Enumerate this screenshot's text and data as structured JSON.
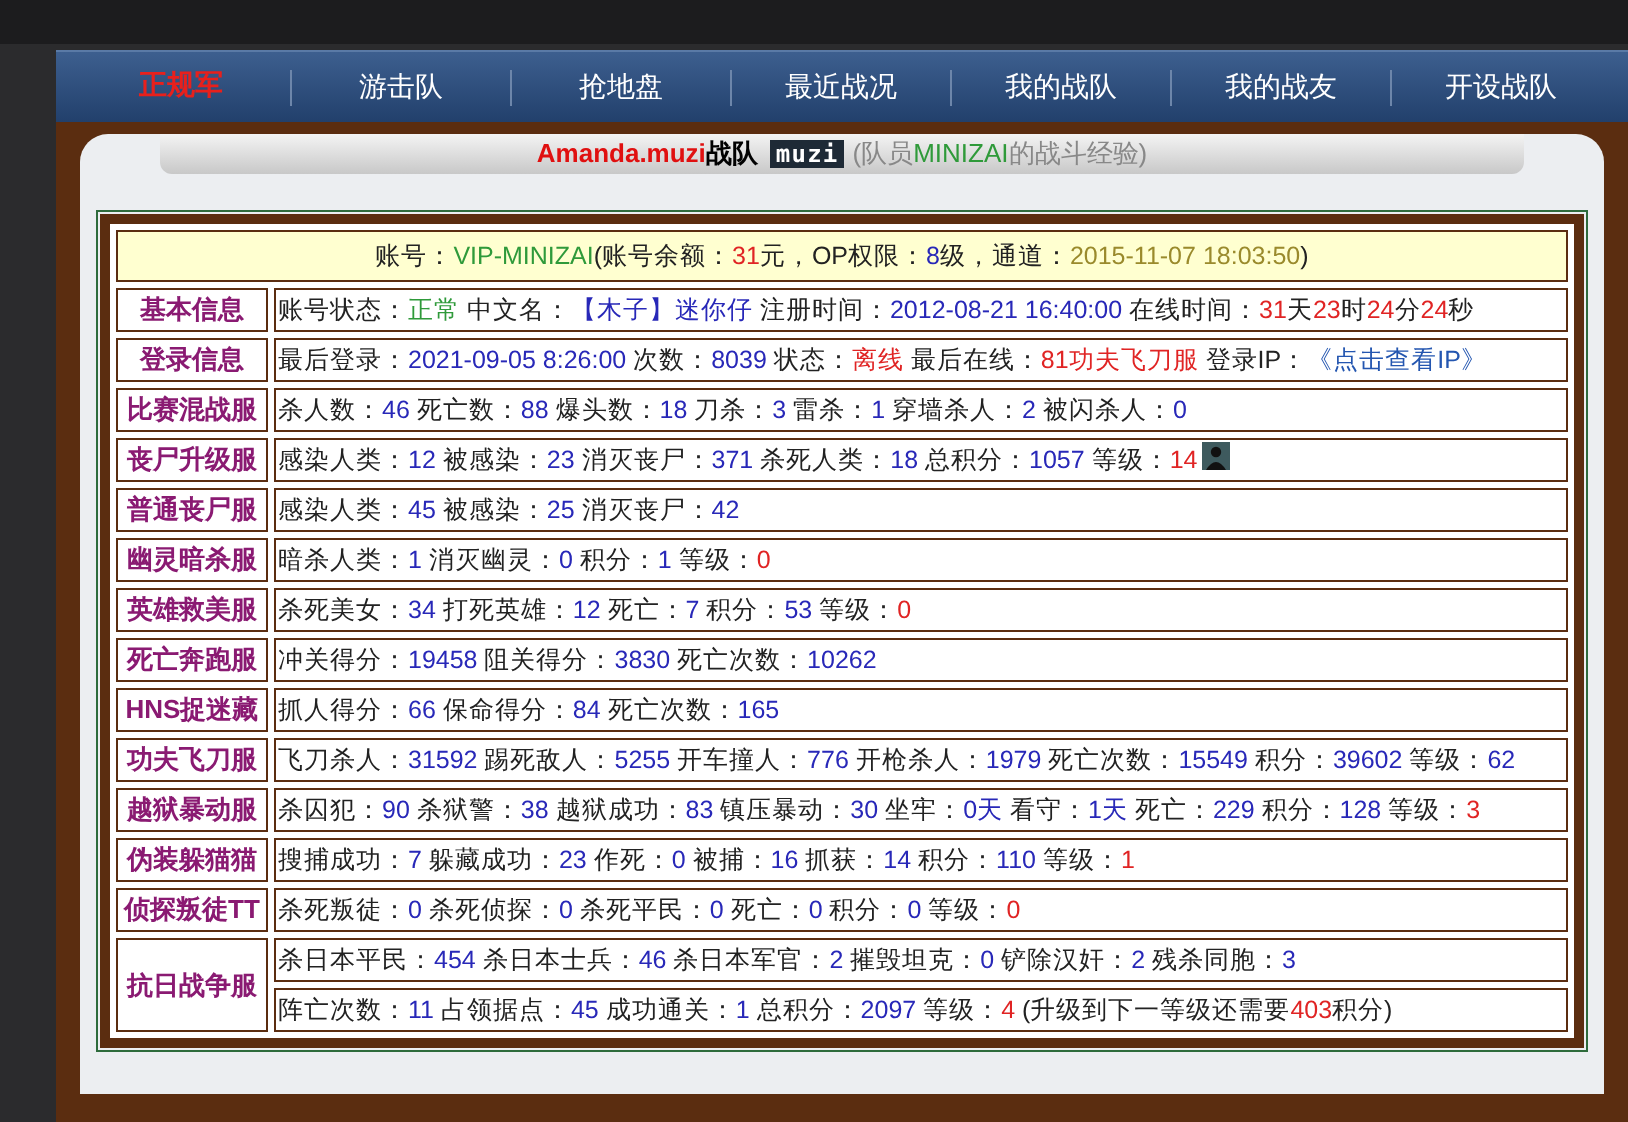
{
  "nav": [
    {
      "label": "正规军",
      "selected": true
    },
    {
      "label": "游击队",
      "selected": false
    },
    {
      "label": "抢地盘",
      "selected": false
    },
    {
      "label": "最近战况",
      "selected": false
    },
    {
      "label": "我的战队",
      "selected": false
    },
    {
      "label": "我的战友",
      "selected": false
    },
    {
      "label": "开设战队",
      "selected": false
    }
  ],
  "header": {
    "team": "Amanda.muzi",
    "team_suffix": "战队",
    "logo": "muzi",
    "subtitle": [
      {
        "kind": "plain",
        "text": "(队员"
      },
      {
        "kind": "green",
        "text": "MINIZAI"
      },
      {
        "kind": "plain",
        "text": "的战斗经验)"
      }
    ]
  },
  "account": [
    {
      "kind": "plain",
      "text": "账号："
    },
    {
      "kind": "green",
      "text": "VIP-MINIZAI"
    },
    {
      "kind": "plain",
      "text": "(账号余额："
    },
    {
      "kind": "red",
      "text": "31"
    },
    {
      "kind": "plain",
      "text": "元，OP权限："
    },
    {
      "kind": "num",
      "text": "8"
    },
    {
      "kind": "plain",
      "text": "级，通道："
    },
    {
      "kind": "gold",
      "text": "2015-11-07 18:03:50"
    },
    {
      "kind": "plain",
      "text": ")"
    }
  ],
  "rows": [
    {
      "label": "基本信息",
      "lines": [
        [
          {
            "kind": "plain",
            "text": "账号状态："
          },
          {
            "kind": "green",
            "text": "正常"
          },
          {
            "kind": "plain",
            "text": " 中文名："
          },
          {
            "kind": "num",
            "text": "【木子】迷你仔"
          },
          {
            "kind": "plain",
            "text": " 注册时间："
          },
          {
            "kind": "num",
            "text": "2012-08-21 16:40:00"
          },
          {
            "kind": "plain",
            "text": " 在线时间："
          },
          {
            "kind": "red",
            "text": "31"
          },
          {
            "kind": "plain",
            "text": "天"
          },
          {
            "kind": "red",
            "text": "23"
          },
          {
            "kind": "plain",
            "text": "时"
          },
          {
            "kind": "red",
            "text": "24"
          },
          {
            "kind": "plain",
            "text": "分"
          },
          {
            "kind": "red",
            "text": "24"
          },
          {
            "kind": "plain",
            "text": "秒"
          }
        ]
      ]
    },
    {
      "label": "登录信息",
      "lines": [
        [
          {
            "kind": "plain",
            "text": "最后登录："
          },
          {
            "kind": "num",
            "text": "2021-09-05 8:26:00"
          },
          {
            "kind": "plain",
            "text": " 次数："
          },
          {
            "kind": "num",
            "text": "8039"
          },
          {
            "kind": "plain",
            "text": " 状态："
          },
          {
            "kind": "red",
            "text": "离线"
          },
          {
            "kind": "plain",
            "text": " 最后在线："
          },
          {
            "kind": "red",
            "text": "81功夫飞刀服"
          },
          {
            "kind": "plain",
            "text": " 登录IP："
          },
          {
            "kind": "link",
            "text": "《点击查看IP》"
          }
        ]
      ]
    },
    {
      "label": "比赛混战服",
      "lines": [
        [
          {
            "kind": "plain",
            "text": "杀人数："
          },
          {
            "kind": "num",
            "text": "46"
          },
          {
            "kind": "plain",
            "text": " 死亡数："
          },
          {
            "kind": "num",
            "text": "88"
          },
          {
            "kind": "plain",
            "text": " 爆头数："
          },
          {
            "kind": "num",
            "text": "18"
          },
          {
            "kind": "plain",
            "text": " 刀杀："
          },
          {
            "kind": "num",
            "text": "3"
          },
          {
            "kind": "plain",
            "text": " 雷杀："
          },
          {
            "kind": "num",
            "text": "1"
          },
          {
            "kind": "plain",
            "text": " 穿墙杀人："
          },
          {
            "kind": "num",
            "text": "2"
          },
          {
            "kind": "plain",
            "text": " 被闪杀人："
          },
          {
            "kind": "num",
            "text": "0"
          }
        ]
      ]
    },
    {
      "label": "丧尸升级服",
      "lines": [
        [
          {
            "kind": "plain",
            "text": "感染人类："
          },
          {
            "kind": "num",
            "text": "12"
          },
          {
            "kind": "plain",
            "text": " 被感染："
          },
          {
            "kind": "num",
            "text": "23"
          },
          {
            "kind": "plain",
            "text": " 消灭丧尸："
          },
          {
            "kind": "num",
            "text": "371"
          },
          {
            "kind": "plain",
            "text": " 杀死人类："
          },
          {
            "kind": "num",
            "text": "18"
          },
          {
            "kind": "plain",
            "text": " 总积分："
          },
          {
            "kind": "num",
            "text": "1057"
          },
          {
            "kind": "plain",
            "text": " 等级："
          },
          {
            "kind": "red",
            "text": "14"
          },
          {
            "kind": "avatar"
          }
        ]
      ]
    },
    {
      "label": "普通丧尸服",
      "lines": [
        [
          {
            "kind": "plain",
            "text": "感染人类："
          },
          {
            "kind": "num",
            "text": "45"
          },
          {
            "kind": "plain",
            "text": " 被感染："
          },
          {
            "kind": "num",
            "text": "25"
          },
          {
            "kind": "plain",
            "text": " 消灭丧尸："
          },
          {
            "kind": "num",
            "text": "42"
          }
        ]
      ]
    },
    {
      "label": "幽灵暗杀服",
      "lines": [
        [
          {
            "kind": "plain",
            "text": "暗杀人类："
          },
          {
            "kind": "num",
            "text": "1"
          },
          {
            "kind": "plain",
            "text": " 消灭幽灵："
          },
          {
            "kind": "num",
            "text": "0"
          },
          {
            "kind": "plain",
            "text": " 积分："
          },
          {
            "kind": "num",
            "text": "1"
          },
          {
            "kind": "plain",
            "text": " 等级："
          },
          {
            "kind": "red",
            "text": "0"
          }
        ]
      ]
    },
    {
      "label": "英雄救美服",
      "lines": [
        [
          {
            "kind": "plain",
            "text": "杀死美女："
          },
          {
            "kind": "num",
            "text": "34"
          },
          {
            "kind": "plain",
            "text": " 打死英雄："
          },
          {
            "kind": "num",
            "text": "12"
          },
          {
            "kind": "plain",
            "text": " 死亡："
          },
          {
            "kind": "num",
            "text": "7"
          },
          {
            "kind": "plain",
            "text": " 积分："
          },
          {
            "kind": "num",
            "text": "53"
          },
          {
            "kind": "plain",
            "text": " 等级："
          },
          {
            "kind": "red",
            "text": "0"
          }
        ]
      ]
    },
    {
      "label": "死亡奔跑服",
      "lines": [
        [
          {
            "kind": "plain",
            "text": "冲关得分："
          },
          {
            "kind": "num",
            "text": "19458"
          },
          {
            "kind": "plain",
            "text": " 阻关得分："
          },
          {
            "kind": "num",
            "text": "3830"
          },
          {
            "kind": "plain",
            "text": " 死亡次数："
          },
          {
            "kind": "num",
            "text": "10262"
          }
        ]
      ]
    },
    {
      "label": "HNS捉迷藏",
      "lines": [
        [
          {
            "kind": "plain",
            "text": "抓人得分："
          },
          {
            "kind": "num",
            "text": "66"
          },
          {
            "kind": "plain",
            "text": " 保命得分："
          },
          {
            "kind": "num",
            "text": "84"
          },
          {
            "kind": "plain",
            "text": " 死亡次数："
          },
          {
            "kind": "num",
            "text": "165"
          }
        ]
      ]
    },
    {
      "label": "功夫飞刀服",
      "lines": [
        [
          {
            "kind": "plain",
            "text": "飞刀杀人："
          },
          {
            "kind": "num",
            "text": "31592"
          },
          {
            "kind": "plain",
            "text": " 踢死敌人："
          },
          {
            "kind": "num",
            "text": "5255"
          },
          {
            "kind": "plain",
            "text": " 开车撞人："
          },
          {
            "kind": "num",
            "text": "776"
          },
          {
            "kind": "plain",
            "text": " 开枪杀人："
          },
          {
            "kind": "num",
            "text": "1979"
          },
          {
            "kind": "plain",
            "text": " 死亡次数："
          },
          {
            "kind": "num",
            "text": "15549"
          },
          {
            "kind": "plain",
            "text": " 积分："
          },
          {
            "kind": "num",
            "text": "39602"
          },
          {
            "kind": "plain",
            "text": " 等级："
          },
          {
            "kind": "num",
            "text": "62"
          }
        ]
      ]
    },
    {
      "label": "越狱暴动服",
      "lines": [
        [
          {
            "kind": "plain",
            "text": "杀囚犯："
          },
          {
            "kind": "num",
            "text": "90"
          },
          {
            "kind": "plain",
            "text": " 杀狱警："
          },
          {
            "kind": "num",
            "text": "38"
          },
          {
            "kind": "plain",
            "text": " 越狱成功："
          },
          {
            "kind": "num",
            "text": "83"
          },
          {
            "kind": "plain",
            "text": " 镇压暴动："
          },
          {
            "kind": "num",
            "text": "30"
          },
          {
            "kind": "plain",
            "text": " 坐牢："
          },
          {
            "kind": "num",
            "text": "0天"
          },
          {
            "kind": "plain",
            "text": " 看守："
          },
          {
            "kind": "num",
            "text": "1天"
          },
          {
            "kind": "plain",
            "text": " 死亡："
          },
          {
            "kind": "num",
            "text": "229"
          },
          {
            "kind": "plain",
            "text": " 积分："
          },
          {
            "kind": "num",
            "text": "128"
          },
          {
            "kind": "plain",
            "text": " 等级："
          },
          {
            "kind": "red",
            "text": "3"
          }
        ]
      ]
    },
    {
      "label": "伪装躲猫猫",
      "lines": [
        [
          {
            "kind": "plain",
            "text": "搜捕成功："
          },
          {
            "kind": "num",
            "text": "7"
          },
          {
            "kind": "plain",
            "text": " 躲藏成功："
          },
          {
            "kind": "num",
            "text": "23"
          },
          {
            "kind": "plain",
            "text": " 作死："
          },
          {
            "kind": "num",
            "text": "0"
          },
          {
            "kind": "plain",
            "text": " 被捕："
          },
          {
            "kind": "num",
            "text": "16"
          },
          {
            "kind": "plain",
            "text": " 抓获："
          },
          {
            "kind": "num",
            "text": "14"
          },
          {
            "kind": "plain",
            "text": " 积分："
          },
          {
            "kind": "num",
            "text": "110"
          },
          {
            "kind": "plain",
            "text": " 等级："
          },
          {
            "kind": "red",
            "text": "1"
          }
        ]
      ]
    },
    {
      "label": "侦探叛徒TT",
      "lines": [
        [
          {
            "kind": "plain",
            "text": "杀死叛徒："
          },
          {
            "kind": "num",
            "text": "0"
          },
          {
            "kind": "plain",
            "text": " 杀死侦探："
          },
          {
            "kind": "num",
            "text": "0"
          },
          {
            "kind": "plain",
            "text": " 杀死平民："
          },
          {
            "kind": "num",
            "text": "0"
          },
          {
            "kind": "plain",
            "text": " 死亡："
          },
          {
            "kind": "num",
            "text": "0"
          },
          {
            "kind": "plain",
            "text": " 积分："
          },
          {
            "kind": "num",
            "text": "0"
          },
          {
            "kind": "plain",
            "text": " 等级："
          },
          {
            "kind": "red",
            "text": "0"
          }
        ]
      ]
    },
    {
      "label": "抗日战争服",
      "lines": [
        [
          {
            "kind": "plain",
            "text": "杀日本平民："
          },
          {
            "kind": "num",
            "text": "454"
          },
          {
            "kind": "plain",
            "text": " 杀日本士兵："
          },
          {
            "kind": "num",
            "text": "46"
          },
          {
            "kind": "plain",
            "text": " 杀日本军官："
          },
          {
            "kind": "num",
            "text": "2"
          },
          {
            "kind": "plain",
            "text": " 摧毁坦克："
          },
          {
            "kind": "num",
            "text": "0"
          },
          {
            "kind": "plain",
            "text": " 铲除汉奸："
          },
          {
            "kind": "num",
            "text": "2"
          },
          {
            "kind": "plain",
            "text": " 残杀同胞："
          },
          {
            "kind": "num",
            "text": "3"
          }
        ],
        [
          {
            "kind": "plain",
            "text": "阵亡次数："
          },
          {
            "kind": "num",
            "text": "11"
          },
          {
            "kind": "plain",
            "text": " 占领据点："
          },
          {
            "kind": "num",
            "text": "45"
          },
          {
            "kind": "plain",
            "text": " 成功通关："
          },
          {
            "kind": "num",
            "text": "1"
          },
          {
            "kind": "plain",
            "text": " 总积分："
          },
          {
            "kind": "num",
            "text": "2097"
          },
          {
            "kind": "plain",
            "text": " 等级："
          },
          {
            "kind": "red",
            "text": "4"
          },
          {
            "kind": "plain",
            "text": " (升级到下一等级还需要"
          },
          {
            "kind": "red",
            "text": "403"
          },
          {
            "kind": "plain",
            "text": "积分)"
          }
        ]
      ]
    }
  ]
}
